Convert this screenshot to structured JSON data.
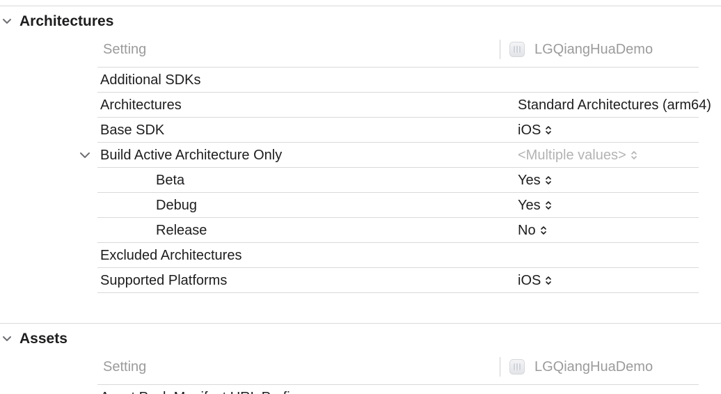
{
  "sections": [
    {
      "title": "Architectures",
      "col_setting": "Setting",
      "col_target": "LGQiangHuaDemo",
      "rows": [
        {
          "name": "Additional SDKs",
          "value": ""
        },
        {
          "name": "Architectures",
          "value": "Standard Architectures (arm64)"
        },
        {
          "name": "Base SDK",
          "value": "iOS"
        },
        {
          "name": "Build Active Architecture Only",
          "value": "<Multiple values>"
        },
        {
          "name": "Beta",
          "value": "Yes"
        },
        {
          "name": "Debug",
          "value": "Yes"
        },
        {
          "name": "Release",
          "value": "No"
        },
        {
          "name": "Excluded Architectures",
          "value": ""
        },
        {
          "name": "Supported Platforms",
          "value": "iOS"
        }
      ]
    },
    {
      "title": "Assets",
      "col_setting": "Setting",
      "col_target": "LGQiangHuaDemo",
      "rows": [
        {
          "name": "Asset Pack Manifest URL Prefix",
          "value": ""
        }
      ]
    }
  ],
  "colors": {
    "text": "#1d1d1f",
    "muted": "#9b9b9b",
    "divider": "#d9d9d9"
  }
}
